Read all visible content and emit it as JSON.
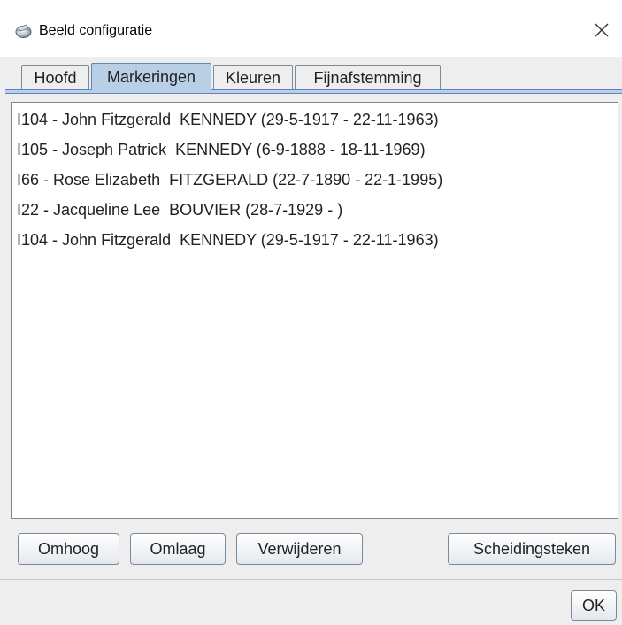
{
  "window": {
    "title": "Beeld configuratie",
    "icon": "app-globe-icon",
    "close_icon": "close-icon"
  },
  "tabs": [
    {
      "label": "Hoofd",
      "selected": false
    },
    {
      "label": "Markeringen",
      "selected": true
    },
    {
      "label": "Kleuren",
      "selected": false
    },
    {
      "label": "Fijnafstemming",
      "selected": false
    }
  ],
  "list": {
    "items": [
      "I104 - John Fitzgerald  KENNEDY (29-5-1917 - 22-11-1963)",
      "I105 - Joseph Patrick  KENNEDY (6-9-1888 - 18-11-1969)",
      "I66 - Rose Elizabeth  FITZGERALD (22-7-1890 - 22-1-1995)",
      "I22 - Jacqueline Lee  BOUVIER (28-7-1929 - )",
      "I104 - John Fitzgerald  KENNEDY (29-5-1917 - 22-11-1963)"
    ]
  },
  "buttons": {
    "up": "Omhoog",
    "down": "Omlaag",
    "remove": "Verwijderen",
    "separator": "Scheidingsteken",
    "ok": "OK"
  },
  "colors": {
    "tab_selected": "#b8cfe5",
    "border_accent": "#6382bf",
    "window_bg": "#eeeeee"
  }
}
